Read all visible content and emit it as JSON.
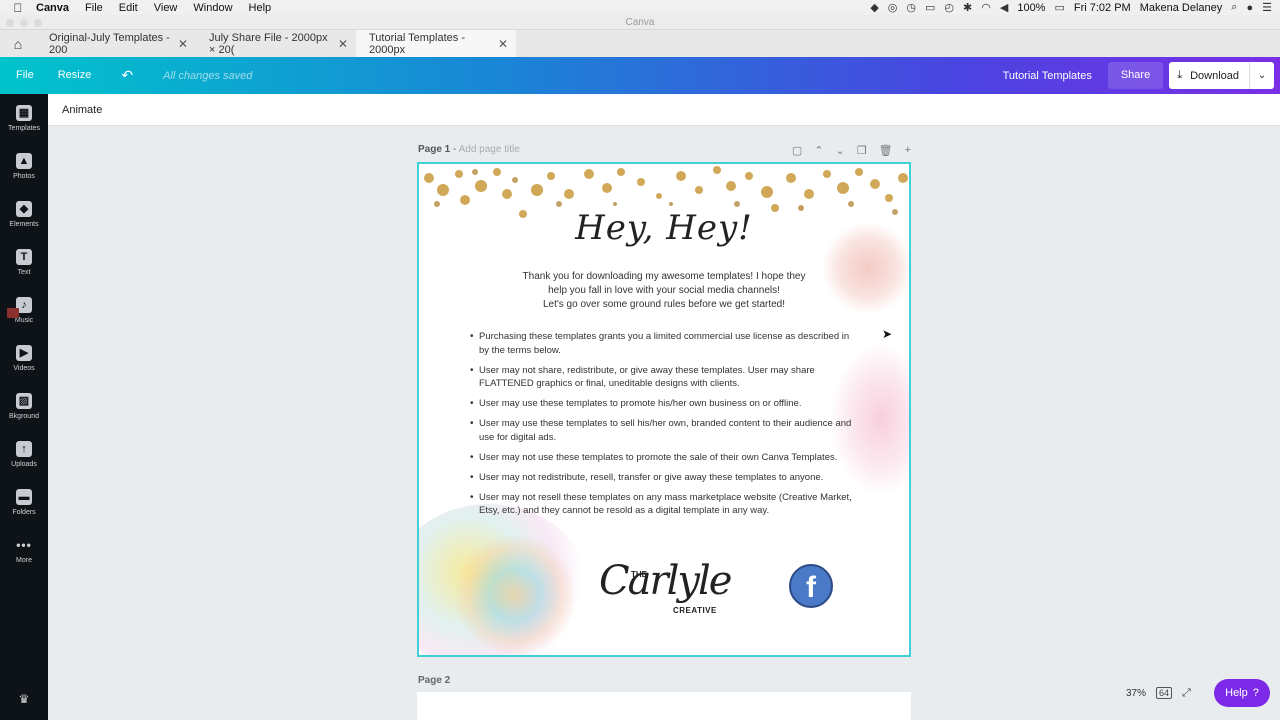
{
  "menubar": {
    "app": "Canva",
    "items": [
      "File",
      "Edit",
      "View",
      "Window",
      "Help"
    ],
    "battery": "100%",
    "clock": "Fri 7:02 PM",
    "user": "Makena Delaney"
  },
  "window": {
    "title": "Canva"
  },
  "tabs": [
    {
      "label": "Original-July Templates - 200"
    },
    {
      "label": "July Share File - 2000px × 20("
    },
    {
      "label": "Tutorial Templates - 2000px"
    }
  ],
  "toolbar": {
    "file": "File",
    "resize": "Resize",
    "saved_status": "All changes saved",
    "design_title": "Tutorial Templates",
    "share": "Share",
    "download": "Download"
  },
  "sidebar": {
    "items": [
      "Templates",
      "Photos",
      "Elements",
      "Text",
      "Music",
      "Videos",
      "Bkground",
      "Uploads",
      "Folders",
      "More"
    ]
  },
  "animate_bar": {
    "label": "Animate"
  },
  "page1": {
    "label": "Page 1",
    "title_placeholder": "Add page title",
    "heading": "Hey, Hey!",
    "intro_lines": [
      "Thank you for downloading my awesome templates! I hope they",
      "help you fall in love with your social media channels!",
      "Let's go over some ground rules before we get started!"
    ],
    "rules": [
      "Purchasing these templates grants you a limited commercial use license as described in by the terms below.",
      "User may not share, redistribute, or give away these templates. User may share FLATTENED graphics or final, uneditable designs with clients.",
      "User may use these templates to promote his/her own business on or offline.",
      "User may use these templates to sell his/her own, branded content to their audience and use for digital ads.",
      "User may not use these templates to promote the sale of their own Canva Templates.",
      "User may not redistribute, resell, transfer or give away these templates to anyone.",
      "User may not resell these templates on any mass marketplace website (Creative Market, Etsy, etc.) and they cannot be resold as a digital template in any way."
    ],
    "logo": {
      "the": "THE",
      "script": "Carlyle",
      "creative": "CREATIVE"
    },
    "facebook_glyph": "f"
  },
  "page2": {
    "label": "Page 2"
  },
  "footer": {
    "zoom": "37%",
    "page_count": "64",
    "help": "Help"
  },
  "colors": {
    "accent": "#7d2ae8",
    "selection": "#41d0d6"
  }
}
